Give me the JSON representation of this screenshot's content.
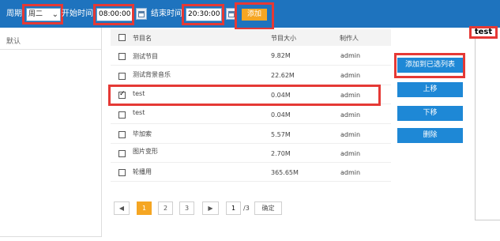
{
  "toolbar": {
    "week_label": "周期",
    "week_value": "周二",
    "start_label": "开始时间",
    "start_value": "08:00:00",
    "end_label": "结束时间",
    "end_value": "20:30:00",
    "add_label": "添加"
  },
  "selected_tag": "test",
  "left_panel": {
    "item": "默认"
  },
  "table": {
    "headers": [
      "节目名",
      "节目大小",
      "制作人"
    ],
    "rows": [
      {
        "name": "测试节目",
        "size": "9.82M",
        "author": "admin",
        "checked": false
      },
      {
        "name": "测试背景音乐",
        "size": "22.62M",
        "author": "admin",
        "checked": false
      },
      {
        "name": "test",
        "size": "0.04M",
        "author": "admin",
        "checked": true
      },
      {
        "name": "test",
        "size": "0.04M",
        "author": "admin",
        "checked": false
      },
      {
        "name": "毕加索",
        "size": "5.57M",
        "author": "admin",
        "checked": false
      },
      {
        "name": "图片变形",
        "size": "2.70M",
        "author": "admin",
        "checked": false
      },
      {
        "name": "轮播用",
        "size": "365.65M",
        "author": "admin",
        "checked": false
      }
    ]
  },
  "actions": {
    "add_to_selected": "添加到已选列表",
    "move_up": "上移",
    "move_down": "下移",
    "delete": "删除"
  },
  "pagination": {
    "prev": "◀",
    "pages": [
      "1",
      "2",
      "3"
    ],
    "next": "▶",
    "current": "1",
    "total": "/3",
    "confirm": "确定"
  }
}
